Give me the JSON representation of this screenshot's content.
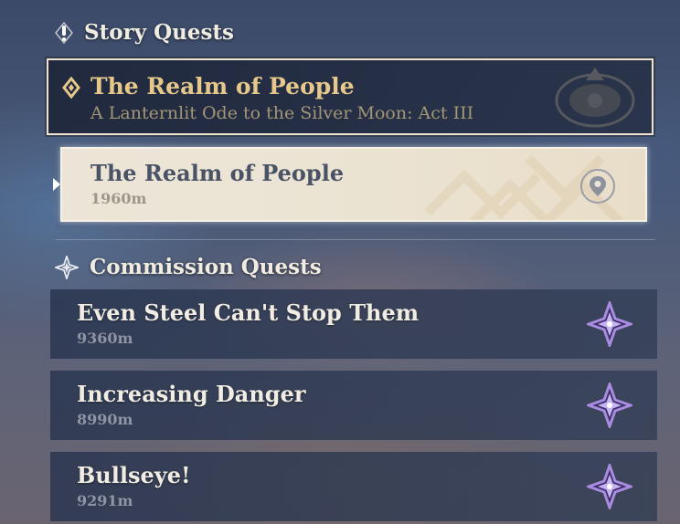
{
  "story_section": {
    "header": "Story Quests",
    "icon": "exclamation-diamond-icon",
    "quest": {
      "title": "The Realm of People",
      "subtitle": "A Lanternlit Ode to the Silver Moon: Act III",
      "title_color": "#e6c98a"
    },
    "objective": {
      "title": "The Realm of People",
      "distance": "1960m",
      "icon": "location-pin-icon"
    }
  },
  "commission_section": {
    "header": "Commission Quests",
    "icon": "commission-star-icon",
    "quests": [
      {
        "title": "Even Steel Can't Stop Them",
        "distance": "9360m",
        "icon": "commission-star-icon"
      },
      {
        "title": "Increasing Danger",
        "distance": "8990m",
        "icon": "commission-star-icon"
      },
      {
        "title": "Bullseye!",
        "distance": "9291m",
        "icon": "commission-star-icon"
      }
    ]
  },
  "colors": {
    "accent_gold": "#e6c98a",
    "selected_bg": "#ece5d7",
    "commission_star": "#a98ce0"
  }
}
